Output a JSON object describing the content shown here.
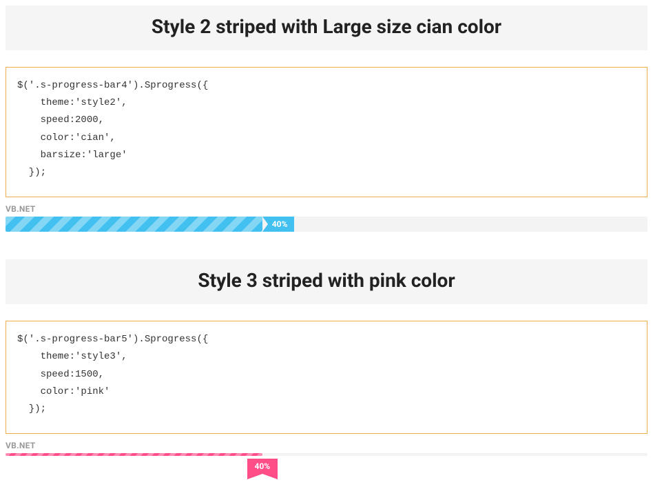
{
  "sections": [
    {
      "title": "Style 2 striped with Large size cian color",
      "code": "$('.s-progress-bar4').Sprogress({\n    theme:'style2',\n    speed:2000,\n    color:'cian',\n    barsize:'large'\n  });",
      "bar_label": "VB.NET",
      "percent_label": "40%"
    },
    {
      "title": "Style 3 striped with pink color",
      "code": "$('.s-progress-bar5').Sprogress({\n    theme:'style3',\n    speed:1500,\n    color:'pink'\n  });",
      "bar_label": "VB.NET",
      "percent_label": "40%"
    }
  ]
}
